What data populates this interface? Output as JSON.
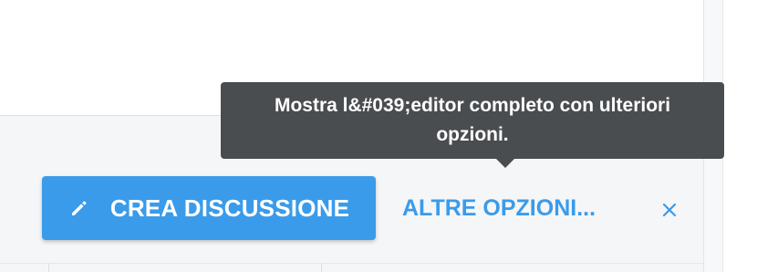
{
  "composer": {
    "create_button_label": "CREA DISCUSSIONE",
    "create_button_icon": "pencil-icon",
    "more_options_label": "ALTRE OPZIONI...",
    "close_icon": "close-icon",
    "tooltip_text": "Mostra l&#039;editor completo con ulteriori opzioni."
  },
  "colors": {
    "primary": "#3a9bea",
    "tooltip_bg": "#4a4d50",
    "footer_bg": "#f5f6f8"
  }
}
